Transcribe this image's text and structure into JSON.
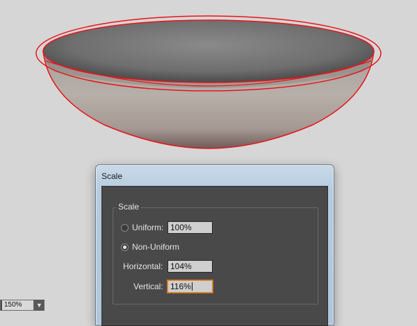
{
  "dialog": {
    "title": "Scale",
    "group_title": "Scale",
    "uniform": {
      "label": "Uniform:",
      "value": "100%",
      "checked": false
    },
    "non_uniform": {
      "label": "Non-Uniform",
      "checked": true
    },
    "horizontal": {
      "label": "Horizontal:",
      "value": "104%"
    },
    "vertical": {
      "label": "Vertical:",
      "value": "116%"
    }
  },
  "status_bar": {
    "zoom_value": "150%",
    "zoom_dropdown_icon": "chevron-down-icon"
  },
  "artwork": {
    "object": "bowl",
    "selection_color": "#e8131b"
  }
}
